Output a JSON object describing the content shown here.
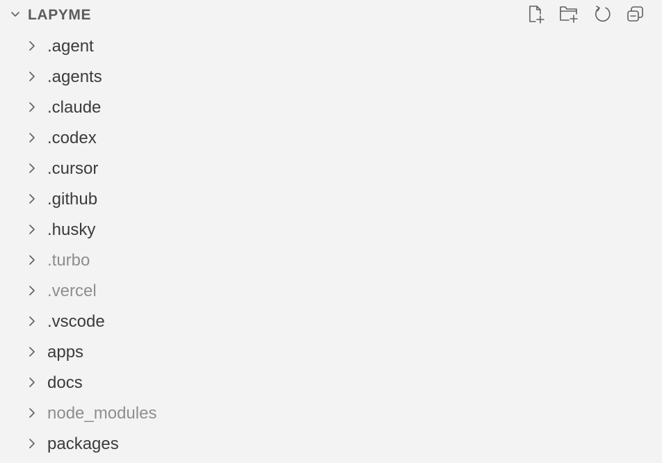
{
  "explorer": {
    "title": "LAPYME",
    "expanded": true,
    "actions": [
      {
        "id": "new-file",
        "icon": "new-file-icon",
        "tooltip": "New File..."
      },
      {
        "id": "new-folder",
        "icon": "new-folder-icon",
        "tooltip": "New Folder..."
      },
      {
        "id": "refresh",
        "icon": "refresh-icon",
        "tooltip": "Refresh Explorer"
      },
      {
        "id": "collapse",
        "icon": "collapse-all-icon",
        "tooltip": "Collapse Folders in Explorer"
      }
    ],
    "items": [
      {
        "label": ".agent",
        "type": "folder",
        "collapsed": true,
        "dimmed": false
      },
      {
        "label": ".agents",
        "type": "folder",
        "collapsed": true,
        "dimmed": false
      },
      {
        "label": ".claude",
        "type": "folder",
        "collapsed": true,
        "dimmed": false
      },
      {
        "label": ".codex",
        "type": "folder",
        "collapsed": true,
        "dimmed": false
      },
      {
        "label": ".cursor",
        "type": "folder",
        "collapsed": true,
        "dimmed": false
      },
      {
        "label": ".github",
        "type": "folder",
        "collapsed": true,
        "dimmed": false
      },
      {
        "label": ".husky",
        "type": "folder",
        "collapsed": true,
        "dimmed": false
      },
      {
        "label": ".turbo",
        "type": "folder",
        "collapsed": true,
        "dimmed": true
      },
      {
        "label": ".vercel",
        "type": "folder",
        "collapsed": true,
        "dimmed": true
      },
      {
        "label": ".vscode",
        "type": "folder",
        "collapsed": true,
        "dimmed": false
      },
      {
        "label": "apps",
        "type": "folder",
        "collapsed": true,
        "dimmed": false
      },
      {
        "label": "docs",
        "type": "folder",
        "collapsed": true,
        "dimmed": false
      },
      {
        "label": "node_modules",
        "type": "folder",
        "collapsed": true,
        "dimmed": true
      },
      {
        "label": "packages",
        "type": "folder",
        "collapsed": true,
        "dimmed": false
      }
    ]
  },
  "colors": {
    "background": "#f3f3f3",
    "text": "#3b3b3b",
    "dimmed_text": "#8e8e8e",
    "header_text": "#5c5c5c",
    "icon": "#5f5f5f"
  }
}
